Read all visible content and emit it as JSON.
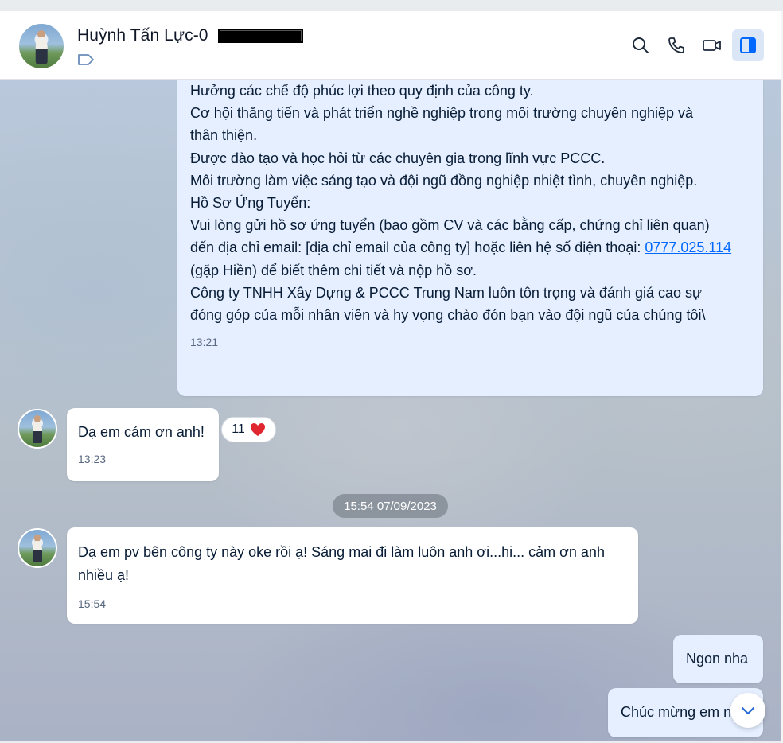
{
  "header": {
    "contact_name": "Huỳnh Tấn Lực-0"
  },
  "messages": {
    "job_post": {
      "lines": [
        "Hưởng các chế độ phúc lợi theo quy định của công ty.",
        "Cơ hội thăng tiến và phát triển nghề nghiệp trong môi trường chuyên nghiệp và",
        "thân thiện.",
        "Được đào tạo và học hỏi từ các chuyên gia trong lĩnh vực PCCC.",
        "Môi trường làm việc sáng tạo và đội ngũ đồng nghiệp nhiệt tình, chuyên nghiệp.",
        "Hồ Sơ Ứng Tuyển:",
        "Vui lòng gửi hồ sơ ứng tuyển (bao gồm CV và các bằng cấp, chứng chỉ liên quan)",
        "đến địa chỉ email: [địa chỉ email của công ty] hoặc liên hệ số điện thoại: ",
        "(gặp Hiền) để biết thêm chi tiết và nộp hồ sơ.",
        "Công ty TNHH Xây Dựng & PCCC Trung Nam luôn tôn trọng và đánh giá cao sự",
        "đóng góp của mỗi nhân viên và hy vọng chào đón bạn vào đội ngũ của chúng tôi\\"
      ],
      "phone_link": "0777.025.114",
      "time": "13:21",
      "reaction_count": "11",
      "reaction_icon": "heart-icon",
      "like_icon": "thumbs-up-icon"
    },
    "thanks": {
      "text": "Dạ em cảm ơn anh!",
      "time": "13:23"
    },
    "date_separator": "15:54 07/09/2023",
    "update": {
      "text_line1": "Dạ em pv bên công ty này oke rồi ạ! Sáng mai đi làm luôn anh ơi...hi... cảm ơn anh",
      "text_line2": "nhiều ạ!",
      "time": "15:54"
    },
    "reply1": {
      "text": "Ngon nha"
    },
    "reply2": {
      "text": "Chúc mừng em n"
    }
  },
  "colors": {
    "accent": "#0068ff",
    "own_bubble": "#e5efff",
    "heart": "#e0262e"
  }
}
